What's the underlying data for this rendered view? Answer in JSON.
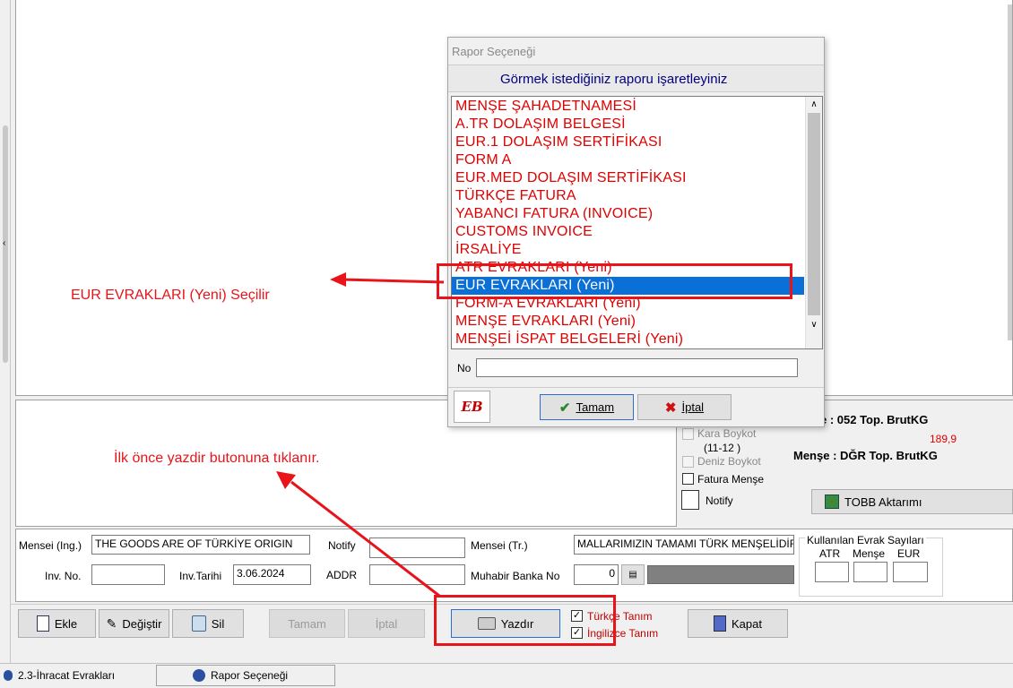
{
  "annotations": {
    "select_note": "EUR EVRAKLARI (Yeni) Seçilir",
    "print_note": "İlk önce yazdir butonuna tıklanır."
  },
  "dialog": {
    "title": "Rapor Seçeneği",
    "header": "Görmek istediğiniz raporu işaretleyiniz",
    "items": [
      "MENŞE ŞAHADETNAMESİ",
      "A.TR    DOLAŞIM BELGESİ",
      "EUR.1    DOLAŞIM SERTİFİKASI",
      "FORM A",
      "EUR.MED DOLAŞIM SERTİFİKASI",
      "TÜRKÇE FATURA",
      "YABANCI FATURA (INVOICE)",
      "CUSTOMS INVOICE",
      "İRSALİYE",
      "ATR EVRAKLARI (Yeni)",
      "EUR EVRAKLARI (Yeni)",
      "FORM-A EVRAKLARI (Yeni)",
      "MENŞE EVRAKLARI (Yeni)",
      "MENŞEİ İSPAT BELGELERİ (Yeni)"
    ],
    "selected_item": "EUR EVRAKLARI (Yeni)",
    "no_label": "No",
    "no_value": "",
    "ok_label": "Tamam",
    "cancel_label": "İptal",
    "logo_text": "EB"
  },
  "right_panel": {
    "mense_052": "e : 052  Top. BrutKG",
    "brut_value": "189,9",
    "mense_dgr": "Menşe : DĞR  Top. BrutKG",
    "kara_boykot": "Kara Boykot",
    "kara_range": "(11-12 )",
    "deniz_boykot": "Deniz Boykot",
    "fatura_mense": "Fatura Menşe",
    "notify": "Notify",
    "tobb_button": "TOBB Aktarımı"
  },
  "form": {
    "mensei_ing_label": "Mensei (Ing.)",
    "mensei_ing_value": "THE GOODS ARE OF TÜRKİYE ORIGIN",
    "notify_label": "Notify",
    "notify_value": "",
    "mensei_tr_label": "Mensei (Tr.)",
    "mensei_tr_value": "MALLARIMIZIN TAMAMI TÜRK MENŞELİDİR",
    "inv_no_label": "Inv. No.",
    "inv_no_value": "",
    "inv_tarihi_label": "Inv.Tarihi",
    "inv_tarihi_value": "3.06.2024",
    "addr_label": "ADDR",
    "addr_value": "",
    "muhabir_label": "Muhabir Banka No",
    "muhabir_value": "0",
    "evrak_title": "Kullanılan Evrak Sayıları",
    "evrak_atr": "ATR",
    "evrak_mense": "Menşe",
    "evrak_eur": "EUR"
  },
  "toolbar": {
    "ekle": "Ekle",
    "degistir": "Değiştir",
    "sil": "Sil",
    "tamam": "Tamam",
    "iptal": "İptal",
    "yazdir": "Yazdır",
    "turkce_tanim": "Türkçe Tanım",
    "ingilizce_tanim": "İngilizce Tanım",
    "kapat": "Kapat"
  },
  "taskbar": {
    "item1": "2.3-İhracat Evrakları",
    "item2": "Rapor Seçeneği"
  },
  "colors": {
    "annotation_red": "#e8141a",
    "list_text_red": "#e00000",
    "selection_blue": "#0a6fd6",
    "header_text_navy": "#000080"
  }
}
